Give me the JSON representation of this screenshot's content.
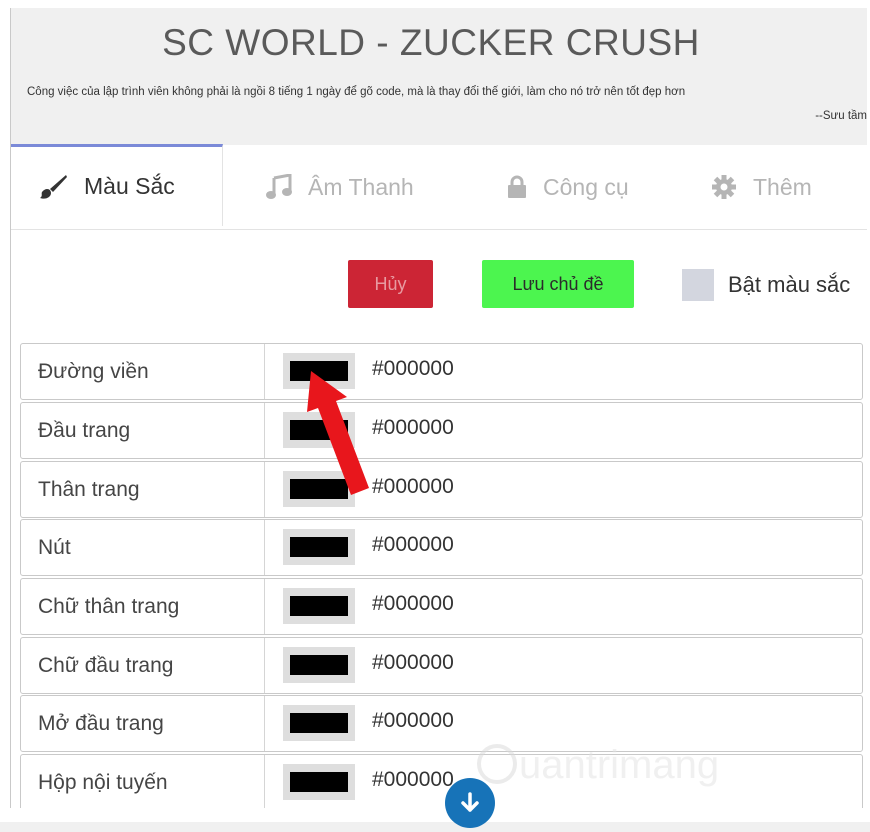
{
  "header": {
    "title": "SC WORLD - ZUCKER CRUSH",
    "quote": "Công việc của lập trình viên không phải là ngồi 8 tiếng 1 ngày để gõ code, mà là thay đổi thế giới, làm cho nó trở nên tốt đẹp hơn",
    "quote_author": "--Sưu tầm"
  },
  "tabs": [
    {
      "label": "Màu Sắc",
      "icon": "paintbrush-icon",
      "active": true
    },
    {
      "label": "Âm Thanh",
      "icon": "music-note-icon",
      "active": false
    },
    {
      "label": "Công cụ",
      "icon": "lock-icon",
      "active": false
    },
    {
      "label": "Thêm",
      "icon": "gear-icon",
      "active": false
    }
  ],
  "actions": {
    "cancel_label": "Hủy",
    "save_label": "Lưu chủ đề",
    "toggle_label": "Bật màu sắc",
    "toggle_checked": false
  },
  "colors": {
    "cancel_bg": "#cc2535",
    "save_bg": "#4cf54f",
    "active_tab_border": "#7b8ad8",
    "scroll_button": "#1773b8",
    "annotation_arrow": "#e8161c"
  },
  "settings": [
    {
      "name": "Đường viền",
      "value": "#000000"
    },
    {
      "name": "Đầu trang",
      "value": "#000000"
    },
    {
      "name": "Thân trang",
      "value": "#000000"
    },
    {
      "name": "Nút",
      "value": "#000000"
    },
    {
      "name": "Chữ thân trang",
      "value": "#000000"
    },
    {
      "name": "Chữ đầu trang",
      "value": "#000000"
    },
    {
      "name": "Mở đầu trang",
      "value": "#000000"
    },
    {
      "name": "Hộp nội tuyến",
      "value": "#000000"
    }
  ],
  "scroll_button_icon": "arrow-down-icon",
  "watermark": "uantrimang"
}
